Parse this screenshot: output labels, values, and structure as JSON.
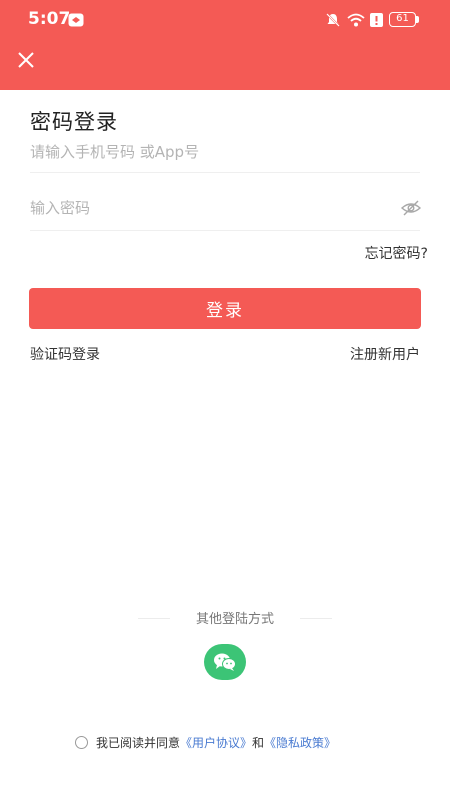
{
  "status_bar": {
    "time": "5:07",
    "battery": "61"
  },
  "login": {
    "title": "密码登录",
    "phone_placeholder": "请输入手机号码 或App号",
    "password_placeholder": "输入密码",
    "forgot_password": "忘记密码?",
    "login_button": "登录",
    "sms_login": "验证码登录",
    "register": "注册新用户"
  },
  "other_login": {
    "label": "其他登陆方式",
    "methods": [
      "wechat-icon"
    ]
  },
  "agreement": {
    "prefix": "我已阅读并同意",
    "user_agreement": "《用户协议》",
    "and": "和",
    "privacy_policy": "《隐私政策》",
    "checked": false
  },
  "colors": {
    "primary": "#f45a55",
    "wechat": "#3cc476",
    "link": "#4a7bd1"
  }
}
